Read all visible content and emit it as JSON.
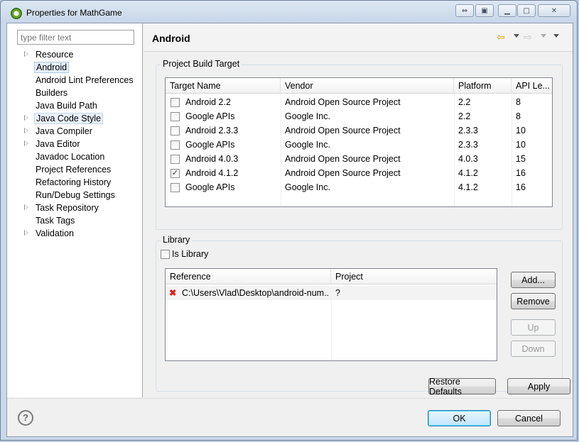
{
  "window": {
    "title": "Properties for MathGame"
  },
  "filter": {
    "placeholder": "type filter text"
  },
  "tree": [
    {
      "label": "Resource",
      "expandable": true
    },
    {
      "label": "Android",
      "expandable": false,
      "selected": true
    },
    {
      "label": "Android Lint Preferences",
      "expandable": false
    },
    {
      "label": "Builders",
      "expandable": false
    },
    {
      "label": "Java Build Path",
      "expandable": false
    },
    {
      "label": "Java Code Style",
      "expandable": true,
      "focused": true
    },
    {
      "label": "Java Compiler",
      "expandable": true
    },
    {
      "label": "Java Editor",
      "expandable": true
    },
    {
      "label": "Javadoc Location",
      "expandable": false
    },
    {
      "label": "Project References",
      "expandable": false
    },
    {
      "label": "Refactoring History",
      "expandable": false
    },
    {
      "label": "Run/Debug Settings",
      "expandable": false
    },
    {
      "label": "Task Repository",
      "expandable": true
    },
    {
      "label": "Task Tags",
      "expandable": false
    },
    {
      "label": "Validation",
      "expandable": true
    }
  ],
  "page": {
    "title": "Android"
  },
  "build_target": {
    "group_label": "Project Build Target",
    "columns": [
      "Target Name",
      "Vendor",
      "Platform",
      "API Le..."
    ],
    "rows": [
      {
        "name": "Android 2.2",
        "vendor": "Android Open Source Project",
        "platform": "2.2",
        "api": "8",
        "checked": false
      },
      {
        "name": "Google APIs",
        "vendor": "Google Inc.",
        "platform": "2.2",
        "api": "8",
        "checked": false
      },
      {
        "name": "Android 2.3.3",
        "vendor": "Android Open Source Project",
        "platform": "2.3.3",
        "api": "10",
        "checked": false
      },
      {
        "name": "Google APIs",
        "vendor": "Google Inc.",
        "platform": "2.3.3",
        "api": "10",
        "checked": false
      },
      {
        "name": "Android 4.0.3",
        "vendor": "Android Open Source Project",
        "platform": "4.0.3",
        "api": "15",
        "checked": false
      },
      {
        "name": "Android 4.1.2",
        "vendor": "Android Open Source Project",
        "platform": "4.1.2",
        "api": "16",
        "checked": true
      },
      {
        "name": "Google APIs",
        "vendor": "Google Inc.",
        "platform": "4.1.2",
        "api": "16",
        "checked": false
      }
    ]
  },
  "library": {
    "group_label": "Library",
    "is_library_label": "Is Library",
    "is_library_checked": false,
    "columns": [
      "Reference",
      "Project"
    ],
    "rows": [
      {
        "reference": "C:\\Users\\Vlad\\Desktop\\android-num...",
        "project": "?"
      }
    ],
    "buttons": {
      "add": "Add...",
      "remove": "Remove",
      "up": "Up",
      "down": "Down"
    }
  },
  "actions": {
    "restore": "Restore Defaults",
    "apply": "Apply",
    "ok": "OK",
    "cancel": "Cancel"
  },
  "help": {
    "glyph": "?"
  },
  "colors": {
    "checkmark": "#333333",
    "error_icon": "#e02020",
    "nav_back": "#d9a200"
  }
}
